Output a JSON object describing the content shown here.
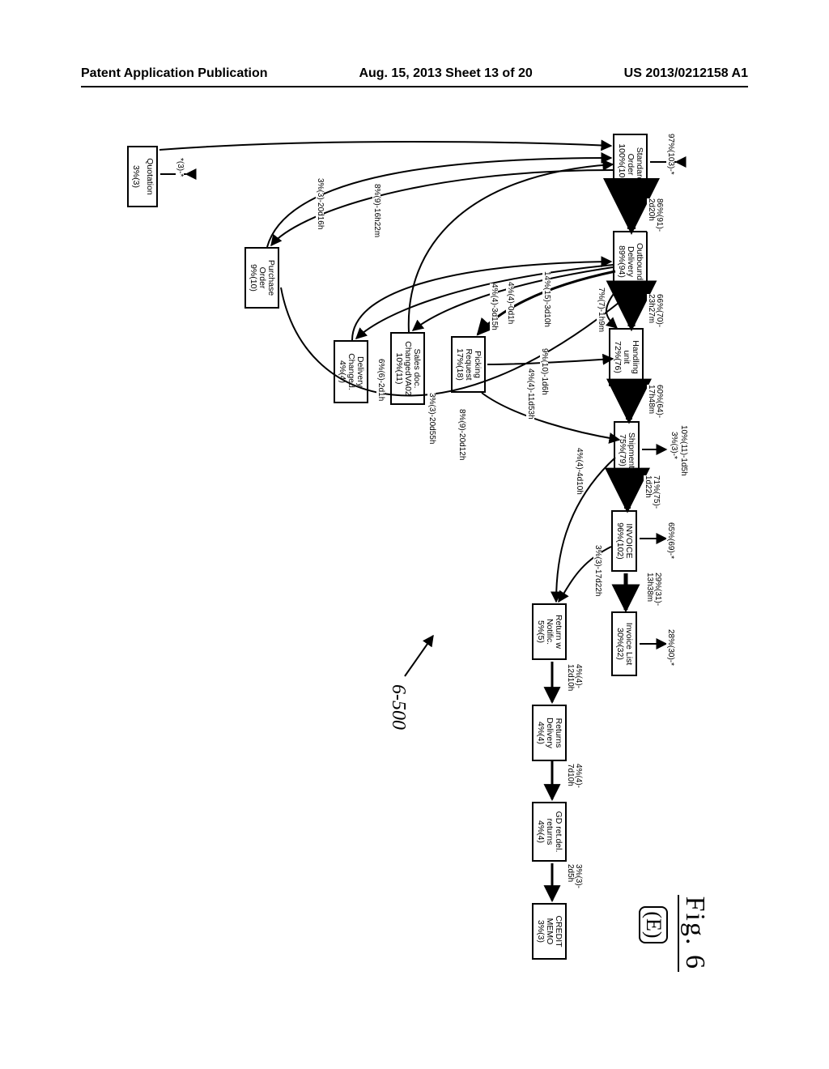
{
  "header": {
    "left": "Patent Application Publication",
    "center": "Aug. 15, 2013  Sheet 13 of 20",
    "right": "US 2013/0212158 A1"
  },
  "figure": {
    "label": "Fig. 6",
    "panel": "(E)",
    "ref": "6-500"
  },
  "chart_data": {
    "type": "diagram",
    "nodes": [
      {
        "id": "stdorder",
        "label": "Standard\nOrder\n100%(106)"
      },
      {
        "id": "outdel",
        "label": "Outbound\nDelivery\n89%(94)"
      },
      {
        "id": "hunit",
        "label": "Handling\nunit\n72%(76)"
      },
      {
        "id": "shipment",
        "label": "Shipment\n75%(79)"
      },
      {
        "id": "invoice",
        "label": "INVOICE\n96%(102)"
      },
      {
        "id": "invlist",
        "label": "Invoice List\n30%(32)"
      },
      {
        "id": "retnot",
        "label": "Return w\nNotific.\n5%(5)"
      },
      {
        "id": "retdel",
        "label": "Returns\nDelivery\n4%(4)"
      },
      {
        "id": "gdret",
        "label": "GD ret.del.\nreturns\n4%(4)"
      },
      {
        "id": "credit",
        "label": "CREDIT\nMEMO\n3%(3)"
      },
      {
        "id": "pickreq",
        "label": "Picking\nRequest\n17%(18)"
      },
      {
        "id": "salesdoc",
        "label": "Sales doc.\nChangedVA02\n10%(11)"
      },
      {
        "id": "delchg",
        "label": "Delivery\nChanged.\n4%(4)"
      },
      {
        "id": "po",
        "label": "Purchase\nOrder\n9%(10)"
      },
      {
        "id": "quot",
        "label": "Quotation\n3%(3)"
      }
    ],
    "edges": [
      {
        "from": "_in",
        "to": "stdorder",
        "label": "97%(103)-*"
      },
      {
        "from": "stdorder",
        "to": "outdel",
        "label": "86%(91)-2d20h"
      },
      {
        "from": "outdel",
        "to": "hunit",
        "label": "66%(70)-23h27m"
      },
      {
        "from": "outdel",
        "to": "hunit",
        "label": "7%(7)-1h9m"
      },
      {
        "from": "hunit",
        "to": "shipment",
        "label": "60%(64)-17h48m"
      },
      {
        "from": "shipment",
        "to": "invoice",
        "label": "71%(75)-1d22h"
      },
      {
        "from": "shipment",
        "to": "_out",
        "label": "3%(3)-*"
      },
      {
        "from": "hunit",
        "to": "_out",
        "label": "10%(11)-1d5h"
      },
      {
        "from": "invoice",
        "to": "_out",
        "label": "65%(69)-*"
      },
      {
        "from": "invoice",
        "to": "invlist",
        "label": "29%(31)-13h38m"
      },
      {
        "from": "invlist",
        "to": "_out",
        "label": "28%(30)-*"
      },
      {
        "from": "invoice",
        "to": "retnot",
        "label": "3%(3)-17d22h"
      },
      {
        "from": "retnot",
        "to": "retdel",
        "label": "4%(4)-12d10h"
      },
      {
        "from": "retdel",
        "to": "gdret",
        "label": "4%(4)-7d10h"
      },
      {
        "from": "gdret",
        "to": "credit",
        "label": "3%(3)-2d5h"
      },
      {
        "from": "shipment",
        "to": "retnot",
        "label": "4%(4)-4d10h"
      },
      {
        "from": "outdel",
        "to": "pickreq",
        "label": "14%(15)-3d10h"
      },
      {
        "from": "pickreq",
        "to": "hunit",
        "label": "9%(10)-1d6h"
      },
      {
        "from": "pickreq",
        "to": "shipment",
        "label": "4%(4)-11d53h"
      },
      {
        "from": "outdel",
        "to": "salesdoc",
        "label": "4%(4)-0d1h"
      },
      {
        "from": "outdel",
        "to": "delchg",
        "label": "4%(4)-3d15h"
      },
      {
        "from": "stdorder",
        "to": "po",
        "label": "8%(9)-16h22m"
      },
      {
        "from": "salesdoc",
        "to": "stdorder",
        "label": "3%(3)-20d55h"
      },
      {
        "from": "delchg",
        "to": "outdel",
        "label": "6%(6)-2d1h"
      },
      {
        "from": "po",
        "to": "outdel",
        "label": "8%(9)-20d12h"
      },
      {
        "from": "po",
        "to": "stdorder",
        "label": "3%(3)-20d16h"
      },
      {
        "from": "_in",
        "to": "quot",
        "label": "*(3)-*"
      },
      {
        "from": "quot",
        "to": "stdorder",
        "label": ""
      }
    ]
  },
  "labels": {
    "in_std": "97%(103)-*",
    "std_out": "86%(91)-\n2d20h",
    "out_hu_a": "66%(70)-\n23h27m",
    "out_hu_b": "7%(7)-1h9m",
    "hu_ship": "60%(64)-\n17h48m",
    "ship_inv": "71%(75)-\n1d22h",
    "ship_top": "3%(3)-*",
    "hu_top": "10%(11)-1d5h",
    "inv_top": "65%(69)-*",
    "inv_list": "29%(31)-\n13h38m",
    "list_top": "28%(30)-*",
    "inv_ret": "3%(3)-17d22h",
    "ret_retdel": "4%(4)-\n12d10h",
    "retdel_gd": "4%(4)-\n7d10h",
    "gd_cred": "3%(3)-\n2d5h",
    "ship_ret": "4%(4)-4d10h",
    "out_pick": "14%(15)-3d10h",
    "pick_hu": "9%(10)-1d6h",
    "pick_ship": "4%(4)-11d53h",
    "out_sales": "4%(4)-0d1h",
    "out_del": "4%(4)-3d15h",
    "std_po": "8%(9)-16h22m",
    "sales_std": "3%(3)-20d55h",
    "del_out": "6%(6)-2d1h",
    "po_out": "8%(9)-20d12h",
    "po_std": "3%(3)-20d16h",
    "in_quot": "*(3)-*"
  },
  "nodes": {
    "stdorder": {
      "l1": "Standard",
      "l2": "Order",
      "l3": "100%(106)"
    },
    "outdel": {
      "l1": "Outbound",
      "l2": "Delivery",
      "l3": "89%(94)"
    },
    "hunit": {
      "l1": "Handling",
      "l2": "unit",
      "l3": "72%(76)"
    },
    "shipment": {
      "l1": "Shipment",
      "l3": "75%(79)"
    },
    "invoice": {
      "l1": "INVOICE",
      "l3": "96%(102)"
    },
    "invlist": {
      "l1": "Invoice List",
      "l3": "30%(32)"
    },
    "retnot": {
      "l1": "Return w",
      "l2": "Notific.",
      "l3": "5%(5)"
    },
    "retdel": {
      "l1": "Returns",
      "l2": "Delivery",
      "l3": "4%(4)"
    },
    "gdret": {
      "l1": "GD ret.del.",
      "l2": "returns",
      "l3": "4%(4)"
    },
    "credit": {
      "l1": "CREDIT",
      "l2": "MEMO",
      "l3": "3%(3)"
    },
    "pickreq": {
      "l1": "Picking",
      "l2": "Request",
      "l3": "17%(18)"
    },
    "salesdoc": {
      "l1": "Sales doc.",
      "l2": "ChangedVA02",
      "l3": "10%(11)"
    },
    "delchg": {
      "l1": "Delivery",
      "l2": "Changed.",
      "l3": "4%(4)"
    },
    "po": {
      "l1": "Purchase",
      "l2": "Order",
      "l3": "9%(10)"
    },
    "quot": {
      "l1": "Quotation",
      "l3": "3%(3)"
    }
  }
}
